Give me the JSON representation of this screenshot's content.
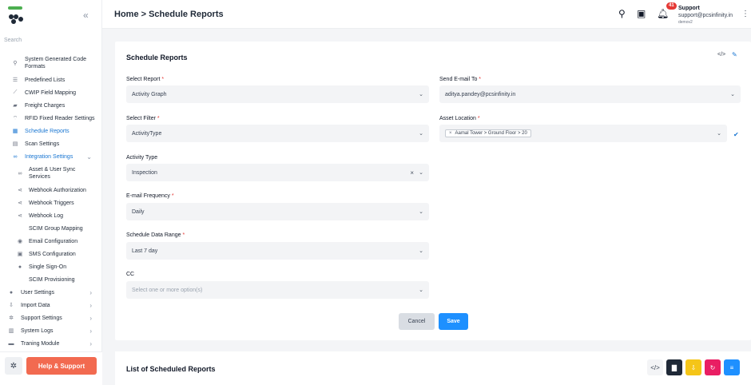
{
  "sidebar": {
    "search_label": "Search",
    "items": [
      {
        "label": "System Generated Code",
        "label2": "Formats"
      },
      {
        "label": "Predefined Lists"
      },
      {
        "label": "CWIP Field Mapping"
      },
      {
        "label": "Freight Charges"
      },
      {
        "label": "RFID Fixed Reader Settings"
      },
      {
        "label": "Schedule Reports"
      },
      {
        "label": "Scan Settings"
      },
      {
        "label": "Integration Settings"
      },
      {
        "label": "Asset & User Sync",
        "label2": "Services"
      },
      {
        "label": "Webhook Authorization"
      },
      {
        "label": "Webhook Triggers"
      },
      {
        "label": "Webhook Log"
      },
      {
        "label": "SCIM Group Mapping"
      },
      {
        "label": "Email Configuration"
      },
      {
        "label": "SMS Configuration"
      },
      {
        "label": "Single Sign-On"
      },
      {
        "label": "SCIM Provisioning"
      },
      {
        "label": "User Settings"
      },
      {
        "label": "Import Data"
      },
      {
        "label": "Support Settings"
      },
      {
        "label": "System Logs"
      },
      {
        "label": "Traning Module"
      }
    ],
    "help_label": "Help & Support"
  },
  "header": {
    "breadcrumb": "Home > Schedule Reports",
    "notification_count": "41",
    "user_name": "Support",
    "user_email": "support@pcsinfinity.in",
    "user_role": "demov2"
  },
  "form": {
    "title": "Schedule Reports",
    "select_report": {
      "label": "Select Report",
      "value": "Activity Graph"
    },
    "send_email_to": {
      "label": "Send E-mail To",
      "value": "aditya.pandey@pcsinfinity.in"
    },
    "select_filter": {
      "label": "Select Filter",
      "value": "ActivityType"
    },
    "asset_location": {
      "label": "Asset Location",
      "chip": "Aamal Tower > Ground Floor > 20"
    },
    "activity_type": {
      "label": "Activity Type",
      "value": "Inspection"
    },
    "email_frequency": {
      "label": "E-mail Frequency",
      "value": "Daily"
    },
    "schedule_data_range": {
      "label": "Schedule Data Range",
      "value": "Last 7 day"
    },
    "cc": {
      "label": "CC",
      "placeholder": "Select one or more option(s)"
    },
    "cancel_label": "Cancel",
    "save_label": "Save"
  },
  "list": {
    "title": "List of Scheduled Reports"
  },
  "colors": {
    "accent": "#1976d2",
    "help": "#f26a50",
    "save": "#1e90ff",
    "pdf": "#1f2937",
    "download": "#f5c518",
    "refresh": "#e91e63",
    "columns": "#1e90ff"
  }
}
